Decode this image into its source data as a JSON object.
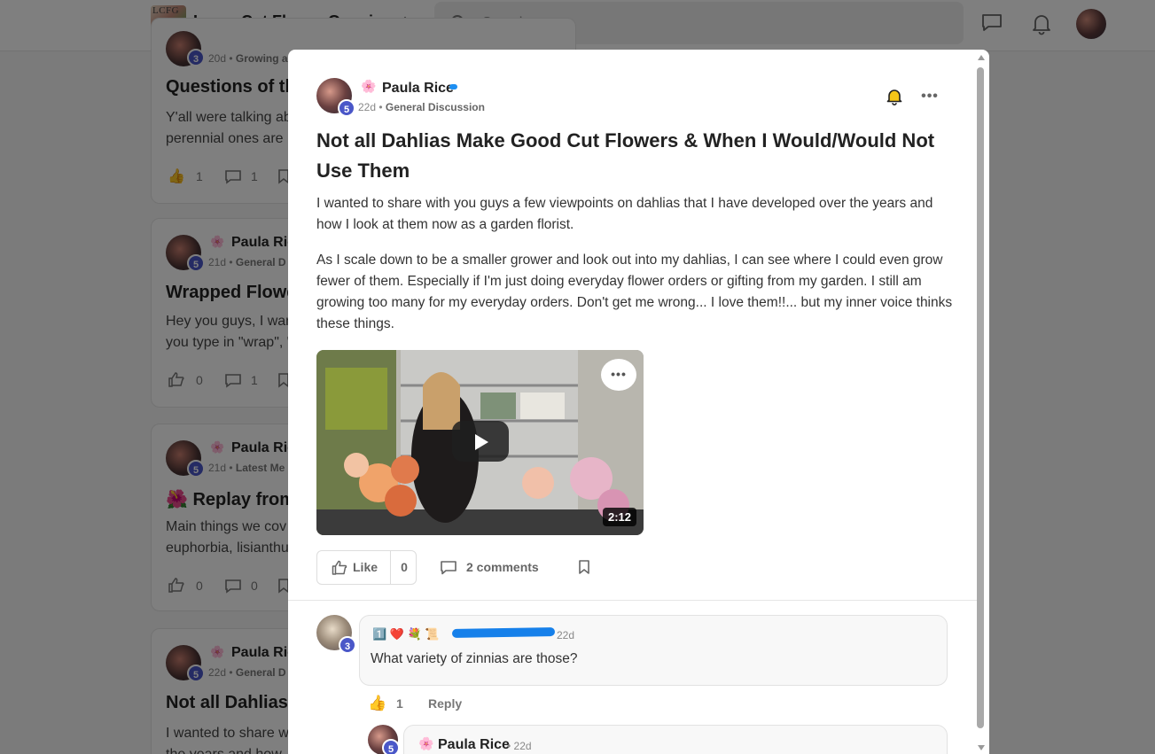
{
  "topbar": {
    "logo_text": "LCFG",
    "title": "Learn Cut Flower Growing",
    "search_placeholder": "Search"
  },
  "feed": [
    {
      "meta_time": "20d",
      "meta_category": "Growing a",
      "title": "Questions of th",
      "snippet_lines": [
        "Y'all were talking ab",
        "perennial ones are l"
      ],
      "likes": "1",
      "comments": "1"
    },
    {
      "author": "Paula Ric",
      "level": "5",
      "meta_time": "21d",
      "meta_category": "General D",
      "title": "Wrapped Flowe",
      "snippet_lines": [
        "Hey you guys, I wan",
        "you type in \"wrap\", \""
      ],
      "likes": "0",
      "comments": "1"
    },
    {
      "author": "Paula Ric",
      "level": "5",
      "meta_time": "21d",
      "meta_category": "Latest Me",
      "title": "Replay from",
      "title_emoji": "🌺",
      "snippet_lines": [
        "Main things we cov",
        "euphorbia, lisianthu"
      ],
      "likes": "0",
      "comments": "0"
    },
    {
      "author": "Paula Ric",
      "level": "5",
      "meta_time": "22d",
      "meta_category": "General D",
      "title": "Not all Dahlias",
      "snippet_lines": [
        "I wanted to share w",
        "the years and how"
      ]
    }
  ],
  "post": {
    "author": "Paula Rice",
    "author_flower": "🌸",
    "level": "5",
    "time": "22d",
    "category": "General Discussion",
    "title": "Not all Dahlias Make Good Cut Flowers & When I Would/Would Not Use Them",
    "paragraphs": [
      "I wanted to share with you guys a few viewpoints on dahlias that I have developed over the years and how I look at them now as a garden florist.",
      "As I scale down to be a smaller grower and look out into my dahlias, I can see where I could even grow fewer of them. Especially if I'm just doing everyday flower orders or gifting from my garden. I still am growing too many for my everyday orders. Don't get me wrong... I love them!!... but my inner voice thinks these things."
    ],
    "video_duration": "2:12",
    "like_label": "Like",
    "like_count": "0",
    "comments_label": "2 comments"
  },
  "comments": [
    {
      "level": "3",
      "badges": "1️⃣ ❤️ 💐 📜",
      "time": "22d",
      "text": "What variety of zinnias are those?",
      "likes": "1",
      "reply_label": "Reply"
    }
  ],
  "reply": {
    "author": "Paula Rice",
    "flower": "🌸",
    "level": "5",
    "time": "• 22d"
  }
}
